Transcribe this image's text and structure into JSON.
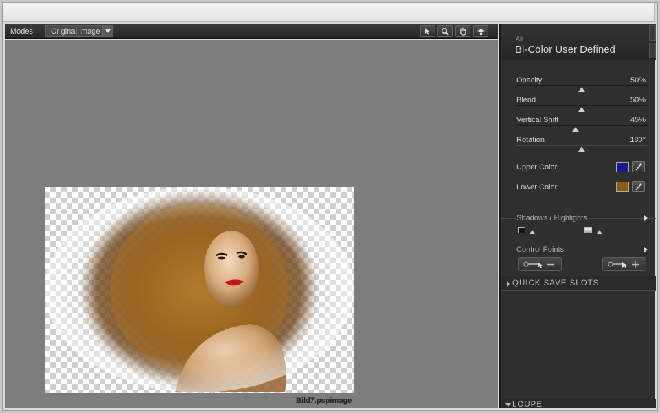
{
  "toolbar": {
    "modes_label": "Modes:",
    "mode_value": "Original Image",
    "tools": [
      "pointer-icon",
      "zoom-icon",
      "hand-icon",
      "light-icon"
    ]
  },
  "canvas": {
    "filename": "Bild7.pspimage"
  },
  "panel": {
    "category": "All",
    "filter_name": "Bi-Color User Defined",
    "sliders": [
      {
        "label": "Opacity",
        "value": "50%",
        "level": 0.5
      },
      {
        "label": "Blend",
        "value": "50%",
        "level": 0.5
      },
      {
        "label": "Vertical Shift",
        "value": "45%",
        "level": 0.45
      },
      {
        "label": "Rotation",
        "value": "180°",
        "level": 0.5
      }
    ],
    "upper_color": {
      "label": "Upper Color",
      "color": "#1c1a8a"
    },
    "lower_color": {
      "label": "Lower Color",
      "color": "#8a5c12"
    },
    "shadows_highlights": {
      "label": "Shadows / Highlights",
      "shadows_level": 0.1,
      "highlights_level": 0.1
    },
    "control_points_label": "Control Points",
    "quick_save_label": "QUICK SAVE SLOTS",
    "loupe_label": "LOUPE"
  }
}
